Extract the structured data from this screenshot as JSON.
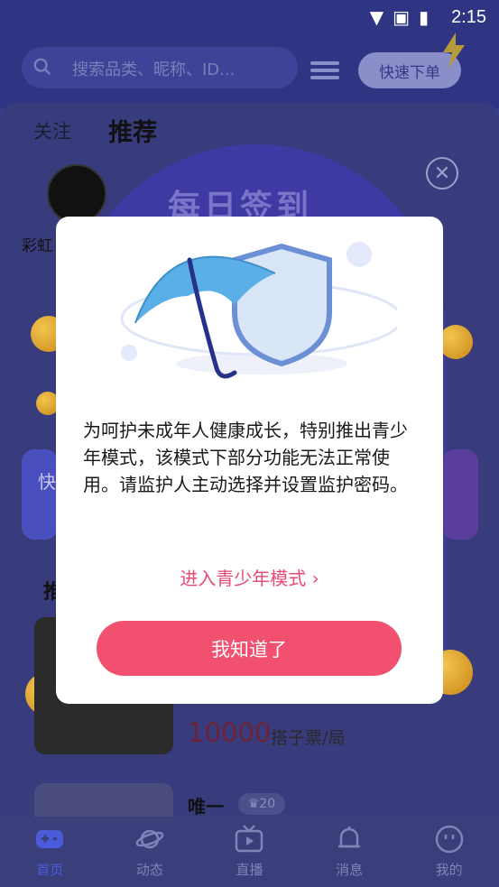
{
  "status_bar": {
    "time": "2:15"
  },
  "header": {
    "search_placeholder": "搜索品类、昵称、ID...",
    "quick_order_label": "快速下单"
  },
  "tabs": {
    "follow": "关注",
    "recommend": "推荐"
  },
  "feed": {
    "user_partial": "彩虹",
    "section_partial": "推",
    "side_left_partial": "快",
    "price": "10000",
    "price_unit": "搭子票/局",
    "user2_name": "唯一",
    "user2_level": "20"
  },
  "signin_banner": {
    "title": "每日签到"
  },
  "modal": {
    "message": "为呵护未成年人健康成长，特别推出青少年模式，该模式下部分功能无法正常使用。请监护人主动选择并设置监护密码。",
    "youth_link": "进入青少年模式",
    "ok_button": "我知道了"
  },
  "nav": {
    "items": [
      {
        "label": "首页",
        "icon": "gamepad-icon"
      },
      {
        "label": "动态",
        "icon": "planet-icon"
      },
      {
        "label": "直播",
        "icon": "tv-icon"
      },
      {
        "label": "消息",
        "icon": "bell-icon"
      },
      {
        "label": "我的",
        "icon": "smile-icon"
      }
    ]
  },
  "colors": {
    "accent": "#f2506f",
    "link": "#e84a73",
    "nav_active": "#4b5bd9"
  }
}
